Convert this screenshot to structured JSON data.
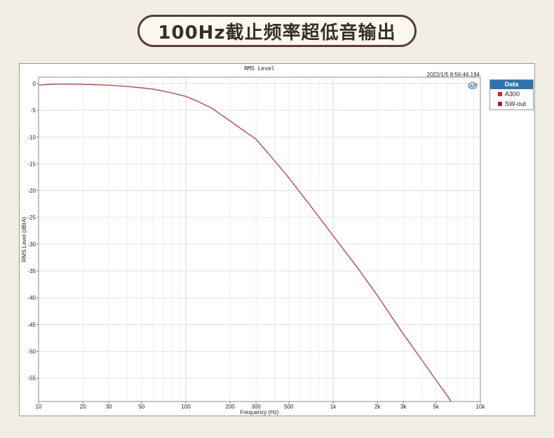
{
  "header": {
    "title": "100Hz截止频率超低音输出"
  },
  "chart_data": {
    "type": "line",
    "title": "RMS Level",
    "timestamp": "2022/1/5 8:56:46.194",
    "xlabel": "Frequency (Hz)",
    "ylabel": "RMS Level (dBrA)",
    "x_scale": "log",
    "xlim": [
      10,
      10000
    ],
    "ylim": [
      -60,
      1
    ],
    "grid": true,
    "x_ticks": [
      {
        "v": 10,
        "label": "10"
      },
      {
        "v": 20,
        "label": "20"
      },
      {
        "v": 30,
        "label": "30"
      },
      {
        "v": 50,
        "label": "50"
      },
      {
        "v": 100,
        "label": "100"
      },
      {
        "v": 200,
        "label": "200"
      },
      {
        "v": 300,
        "label": "300"
      },
      {
        "v": 500,
        "label": "500"
      },
      {
        "v": 1000,
        "label": "1k"
      },
      {
        "v": 2000,
        "label": "2k"
      },
      {
        "v": 3000,
        "label": "3k"
      },
      {
        "v": 5000,
        "label": "5k"
      },
      {
        "v": 10000,
        "label": "10k"
      }
    ],
    "y_ticks": [
      0,
      -5,
      -10,
      -15,
      -20,
      -25,
      -30,
      -35,
      -40,
      -45,
      -50,
      -55
    ],
    "legend": {
      "title": "Data",
      "placement": "right",
      "entries": [
        {
          "name": "A300",
          "color": "#e02020"
        },
        {
          "name": "SW-out",
          "color": "#b01c1c"
        }
      ]
    },
    "series": [
      {
        "name": "A300",
        "color": "#cc2a2a",
        "x": [
          10,
          12,
          15,
          20,
          30,
          40,
          50,
          60,
          70,
          80,
          100,
          120,
          150,
          200,
          250,
          300,
          400,
          500,
          700,
          1000,
          1500,
          2000,
          3000,
          4000,
          5000,
          6000,
          6300
        ],
        "y": [
          -0.3,
          -0.15,
          -0.1,
          -0.15,
          -0.3,
          -0.55,
          -0.8,
          -1.05,
          -1.4,
          -1.75,
          -2.4,
          -3.3,
          -4.6,
          -7.0,
          -8.9,
          -10.4,
          -14.4,
          -17.6,
          -22.8,
          -28.4,
          -34.8,
          -39.6,
          -46.8,
          -51.6,
          -55.4,
          -58.4,
          -59.3
        ]
      }
    ]
  }
}
